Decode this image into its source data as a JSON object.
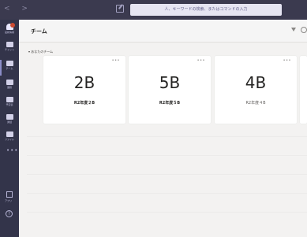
{
  "search": {
    "text": "人、キーワードの検索、またはコマンドの入力"
  },
  "rail": {
    "items": [
      {
        "label": "最新情報",
        "icon": "bell-icon"
      },
      {
        "label": "チャット",
        "icon": "chat-icon"
      },
      {
        "label": "チーム",
        "icon": "teams-icon"
      },
      {
        "label": "課題",
        "icon": "assignment-icon"
      },
      {
        "label": "予定表",
        "icon": "calendar-icon"
      },
      {
        "label": "通話",
        "icon": "phone-icon"
      },
      {
        "label": "ファイル",
        "icon": "file-icon"
      }
    ],
    "more": "•••",
    "apps_label": "アプリ",
    "help_icon": "?"
  },
  "header": {
    "title": "チーム"
  },
  "section": {
    "label": "▾ あなたのチーム"
  },
  "teams": [
    {
      "abbr": "2B",
      "name": "R2年度２B",
      "more": "•••"
    },
    {
      "abbr": "5B",
      "name": "R2年度５B",
      "more": "•••"
    },
    {
      "abbr": "4B",
      "name": "R2年度４B",
      "more": "•••"
    }
  ],
  "colors": {
    "rail": "#33344a",
    "topbar": "#3b3a4f",
    "accent": "#8b8cc7",
    "badge": "#cc4a31"
  }
}
